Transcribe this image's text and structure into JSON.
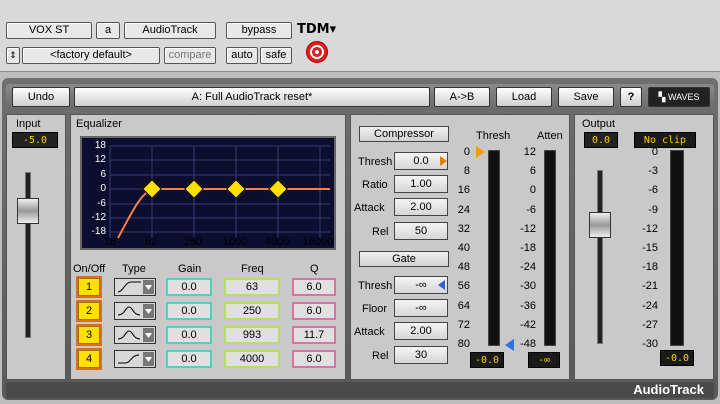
{
  "host": {
    "track": "VOX ST",
    "slot": "a",
    "plugin": "AudioTrack",
    "bypass": "bypass",
    "tdm": "TDM",
    "tdm_arrow": "▾",
    "preset": "<factory default>",
    "compare": "compare",
    "auto": "auto",
    "safe": "safe"
  },
  "toolbar": {
    "undo": "Undo",
    "preset_name": "A: Full AudioTrack reset*",
    "ab": "A->B",
    "load": "Load",
    "save": "Save",
    "help": "?",
    "brand": "WAVES"
  },
  "input": {
    "label": "Input",
    "value": "-5.0"
  },
  "output": {
    "label": "Output",
    "value": "0.0",
    "clip": "No clip",
    "meter_value": "-0.0"
  },
  "equalizer": {
    "title": "Equalizer",
    "y_ticks": [
      "18",
      "12",
      "6",
      "0",
      "-6",
      "-12",
      "-18"
    ],
    "x_ticks": [
      "16",
      "62",
      "250",
      "1000",
      "4000",
      "16000"
    ],
    "headers": {
      "onoff": "On/Off",
      "type": "Type",
      "gain": "Gain",
      "freq": "Freq",
      "q": "Q"
    },
    "bands": [
      {
        "num": "1",
        "gain": "0.0",
        "freq": "63",
        "q": "6.0"
      },
      {
        "num": "2",
        "gain": "0.0",
        "freq": "250",
        "q": "6.0"
      },
      {
        "num": "3",
        "gain": "0.0",
        "freq": "993",
        "q": "11.7"
      },
      {
        "num": "4",
        "gain": "0.0",
        "freq": "4000",
        "q": "6.0"
      }
    ]
  },
  "compressor": {
    "title": "Compressor",
    "thresh_label": "Thresh",
    "thresh": "0.0",
    "ratio_label": "Ratio",
    "ratio": "1.00",
    "attack_label": "Attack",
    "attack": "2.00",
    "rel_label": "Rel",
    "rel": "50"
  },
  "gate": {
    "title": "Gate",
    "thresh_label": "Thresh",
    "thresh": "-∞",
    "floor_label": "Floor",
    "floor": "-∞",
    "attack_label": "Attack",
    "attack": "2.00",
    "rel_label": "Rel",
    "rel": "30"
  },
  "meters": {
    "thresh_label": "Thresh",
    "atten_label": "Atten",
    "thresh_scale": [
      "0",
      "8",
      "16",
      "24",
      "32",
      "40",
      "48",
      "56",
      "64",
      "72",
      "80"
    ],
    "atten_scale": [
      "12",
      "6",
      "0",
      "-6",
      "-12",
      "-18",
      "-24",
      "-30",
      "-36",
      "-42",
      "-48"
    ],
    "thresh_value": "-0.0",
    "atten_value": "-∞"
  },
  "output_scale": [
    "0",
    "-3",
    "-6",
    "-9",
    "-12",
    "-15",
    "-18",
    "-21",
    "-24",
    "-27",
    "-30"
  ],
  "footer": {
    "name": "AudioTrack"
  }
}
